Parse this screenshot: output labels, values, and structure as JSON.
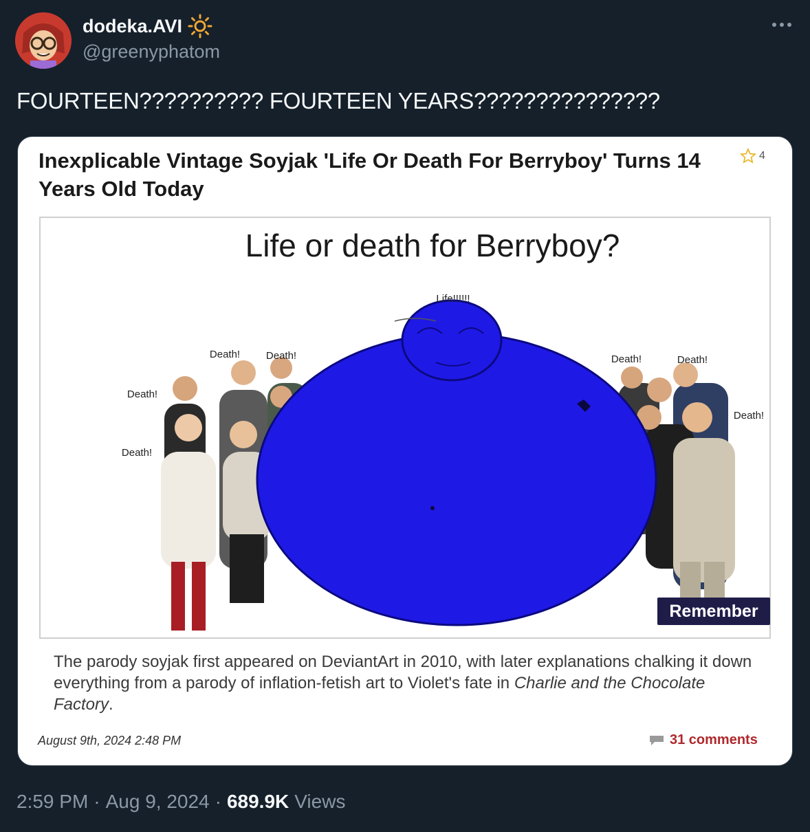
{
  "tweet": {
    "display_name": "dodeka.AVI",
    "handle": "@greenyphatom",
    "text": "FOURTEEN?????????? FOURTEEN YEARS???????????????",
    "time": "2:59 PM",
    "date": "Aug 9, 2024",
    "separator": "·",
    "views_count": "689.9K",
    "views_label": "Views"
  },
  "icons": {
    "avatar": "avatar-cartoon",
    "verified": "sun-icon",
    "more": "more-icon",
    "star": "star-icon",
    "comment": "comment-icon"
  },
  "card": {
    "title": "Inexplicable Vintage Soyjak 'Life Or Death For Berryboy' Turns 14 Years Old Today",
    "star_count": "4",
    "image": {
      "heading": "Life or death for Berryboy?",
      "life_label": "Life!!!!!!",
      "death_label": "Death!",
      "remember_button": "Remember"
    },
    "caption_before": "The parody soyjak first appeared on DeviantArt in 2010, with later explanations chalking it down everything from a parody of inflation-fetish art to Violet's fate in ",
    "caption_italic": "Charlie and the Chocolate Factory",
    "caption_after": ".",
    "date": "August 9th, 2024 2:48 PM",
    "comments": "31 comments"
  },
  "colors": {
    "background": "#15202b",
    "text_primary": "#f7f9f9",
    "text_secondary": "#8b98a5",
    "blueberry": "#1f19e6",
    "remember_bg": "#1f1d48",
    "comments": "#b0282c"
  }
}
